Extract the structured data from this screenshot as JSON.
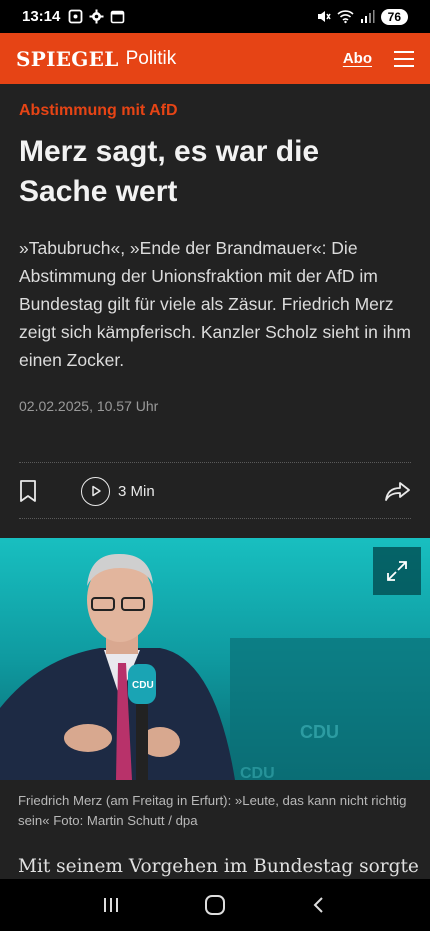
{
  "status_bar": {
    "time": "13:14",
    "battery": "76",
    "left_icons": [
      "screenshot-icon",
      "gear-icon",
      "calendar-icon"
    ],
    "right_icons": [
      "mute-icon",
      "wifi-icon",
      "signal-icon"
    ]
  },
  "header": {
    "brand": "SPIEGEL",
    "section": "Politik",
    "abo_label": "Abo",
    "accent_color": "#e64415"
  },
  "article": {
    "kicker": "Abstimmung mit AfD",
    "headline": "Merz sagt, es war die Sache wert",
    "teaser": "»Tabubruch«, »Ende der Brandmauer«: Die Abstimmung der Unionsfraktion mit der AfD im Bundestag gilt für viele als Zäsur. Friedrich Merz zeigt sich kämpferisch. Kanzler Scholz sieht in ihm einen Zocker.",
    "date": "02.02.2025, 10.57 Uhr",
    "audio_duration": "3 Min",
    "caption": "Friedrich Merz (am Freitag in Erfurt): »Leute, das kann nicht richtig sein«  Foto: Martin Schutt / dpa",
    "body_start": "Mit seinem Vorgehen im Bundestag sorgte"
  },
  "photo": {
    "mic_label": "CDU"
  }
}
